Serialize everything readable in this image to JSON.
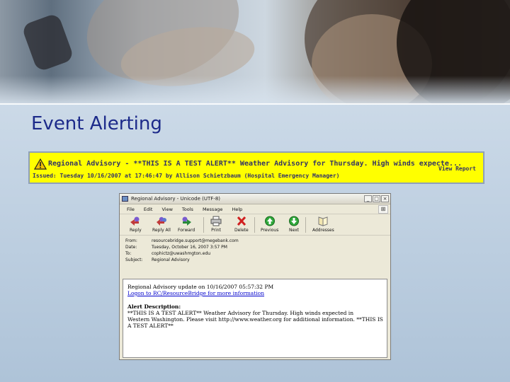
{
  "slide": {
    "title": "Event Alerting"
  },
  "alert": {
    "headline": "Regional Advisory - **THIS IS A TEST ALERT** Weather Advisory for Thursday. High winds expecte...",
    "issued": "Issued: Tuesday 10/16/2007 at 17:46:47 by Allison Schietzbaum (Hospital Emergency Manager)",
    "view_report": "View Report",
    "icon": "warning-icon",
    "background_color": "#ffff00",
    "text_color": "#333366"
  },
  "email": {
    "window_title": "Regional Advisory - Unicode (UTF-8)",
    "window_buttons": [
      "_",
      "□",
      "×"
    ],
    "menu": [
      "File",
      "Edit",
      "View",
      "Tools",
      "Message",
      "Help"
    ],
    "toolbar": [
      {
        "label": "Reply",
        "icon": "reply-icon"
      },
      {
        "label": "Reply All",
        "icon": "reply-all-icon"
      },
      {
        "label": "Forward",
        "icon": "forward-icon"
      },
      {
        "label": "Print",
        "icon": "print-icon"
      },
      {
        "label": "Delete",
        "icon": "delete-icon"
      },
      {
        "label": "Previous",
        "icon": "previous-icon"
      },
      {
        "label": "Next",
        "icon": "next-icon"
      },
      {
        "label": "Addresses",
        "icon": "addresses-icon"
      }
    ],
    "headers": [
      {
        "label": "From:",
        "value": "resourcebridge.support@megebank.com"
      },
      {
        "label": "Date:",
        "value": "Tuesday, October 16, 2007 3:57 PM"
      },
      {
        "label": "To:",
        "value": "cophictz@uwashmgton.edu"
      },
      {
        "label": "Subject:",
        "value": "Regional Advisory"
      }
    ],
    "body": {
      "line1": "Regional Advisory update on 10/16/2007 05:57:32 PM",
      "link": "Logon to RC/ResourceBridge for more information",
      "desc_label": "Alert Description:",
      "desc_lines": [
        "**THIS IS A TEST ALERT** Weather Advisory for Thursday. High winds expected in",
        "Western Washington. Please visit http://www.weather.org for additional information. **THIS IS",
        "A TEST ALERT**"
      ]
    }
  }
}
